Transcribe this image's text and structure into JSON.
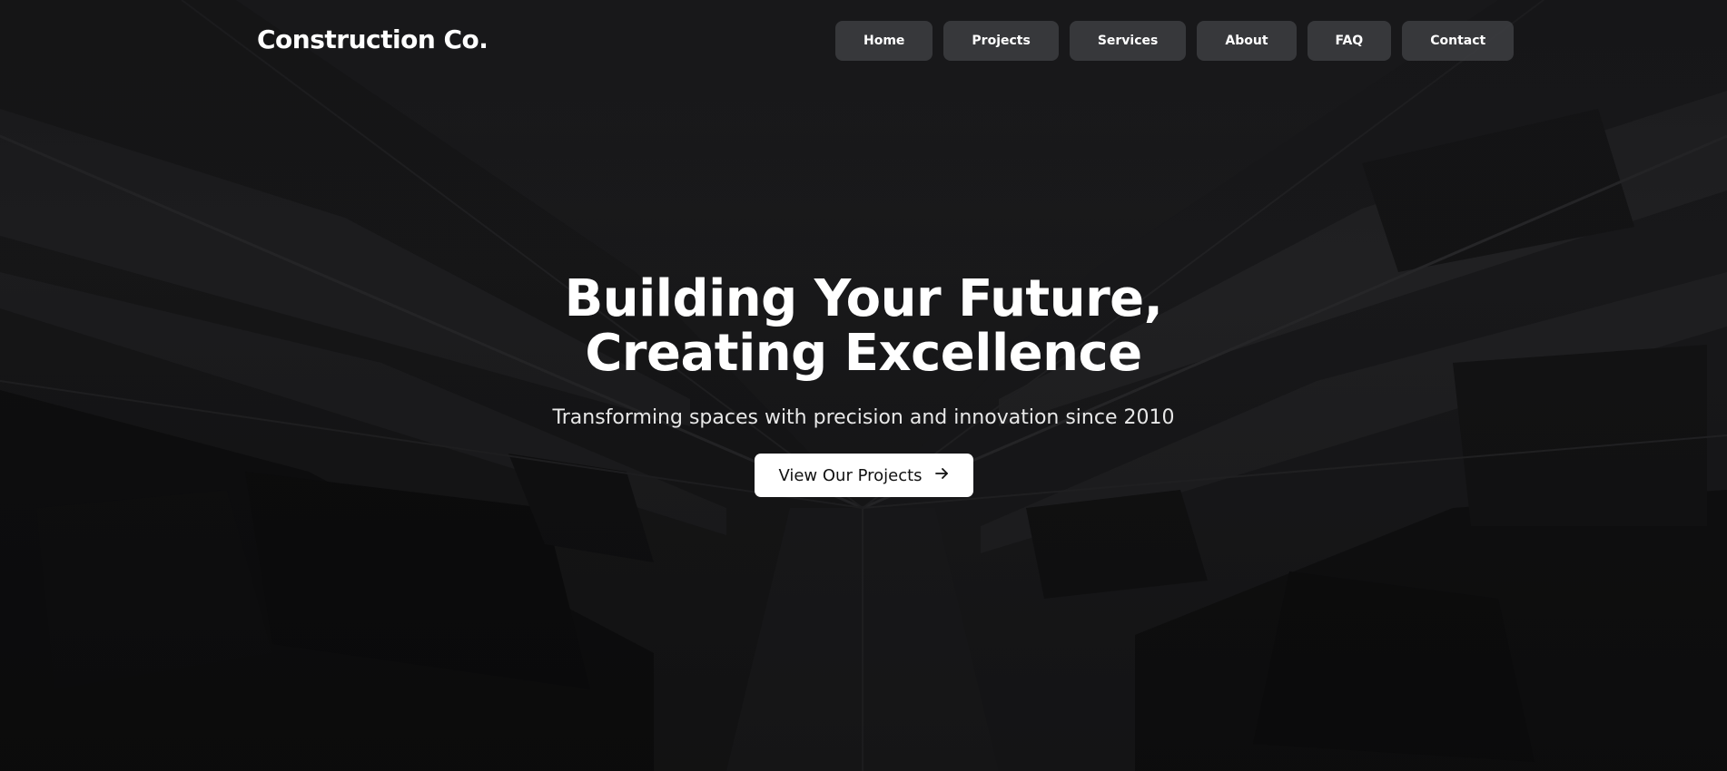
{
  "brand": {
    "name": "Construction Co."
  },
  "nav": {
    "items": [
      {
        "label": "Home"
      },
      {
        "label": "Projects"
      },
      {
        "label": "Services"
      },
      {
        "label": "About"
      },
      {
        "label": "FAQ"
      },
      {
        "label": "Contact"
      }
    ]
  },
  "hero": {
    "headline_line1": "Building Your Future,",
    "headline_line2": "Creating Excellence",
    "subtitle": "Transforming spaces with precision and innovation since 2010",
    "cta_label": "View Our Projects",
    "cta_icon": "arrow-right-icon"
  },
  "colors": {
    "background": "#1a1a1c",
    "nav_button": "#3e3f43",
    "cta_background": "#ffffff",
    "cta_text": "#111111",
    "text": "#ffffff"
  }
}
